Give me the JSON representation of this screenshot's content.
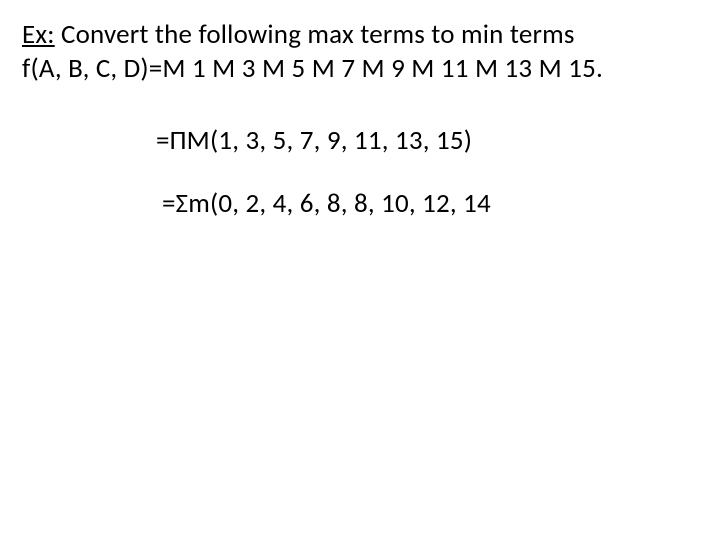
{
  "problem": {
    "label": "Ex:",
    "prompt_part1": " Convert the following  max terms to min terms",
    "function_def": "f(A, B, C, D)=M 1 M 3 M 5 M 7 M 9 M 11 M 13 M 15."
  },
  "solution": {
    "product_of_maxterms": "=ΠM(1, 3, 5, 7, 9, 11, 13, 15)",
    "sum_of_minterms": "=Σm(0, 2, 4, 6, 8, 8, 10, 12, 14"
  }
}
